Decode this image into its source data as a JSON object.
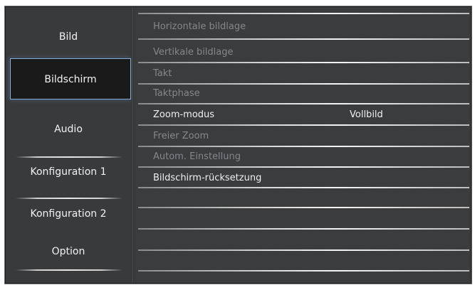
{
  "sidebar": {
    "items": [
      {
        "label": "Bild"
      },
      {
        "label": "Bildschirm"
      },
      {
        "label": "Audio"
      },
      {
        "label": "Konfiguration 1"
      },
      {
        "label": "Konfiguration 2"
      },
      {
        "label": "Option"
      }
    ],
    "active_index": 1
  },
  "menu": {
    "rows": [
      {
        "label": "Horizontale bildlage",
        "value": "",
        "enabled": false
      },
      {
        "label": "Vertikale bildlage",
        "value": "",
        "enabled": false
      },
      {
        "label": "Takt",
        "value": "",
        "enabled": false
      },
      {
        "label": "Taktphase",
        "value": "",
        "enabled": false
      },
      {
        "label": "Zoom-modus",
        "value": "Vollbild",
        "enabled": true
      },
      {
        "label": "Freier Zoom",
        "value": "",
        "enabled": false
      },
      {
        "label": "Autom. Einstellung",
        "value": "",
        "enabled": false
      },
      {
        "label": "Bildschirm-rücksetzung",
        "value": "",
        "enabled": true
      }
    ]
  },
  "colors": {
    "panel": "#3b3c3e",
    "active_border": "#8fb3d6",
    "text": "#f0f0f0",
    "disabled_text": "#85878a"
  }
}
